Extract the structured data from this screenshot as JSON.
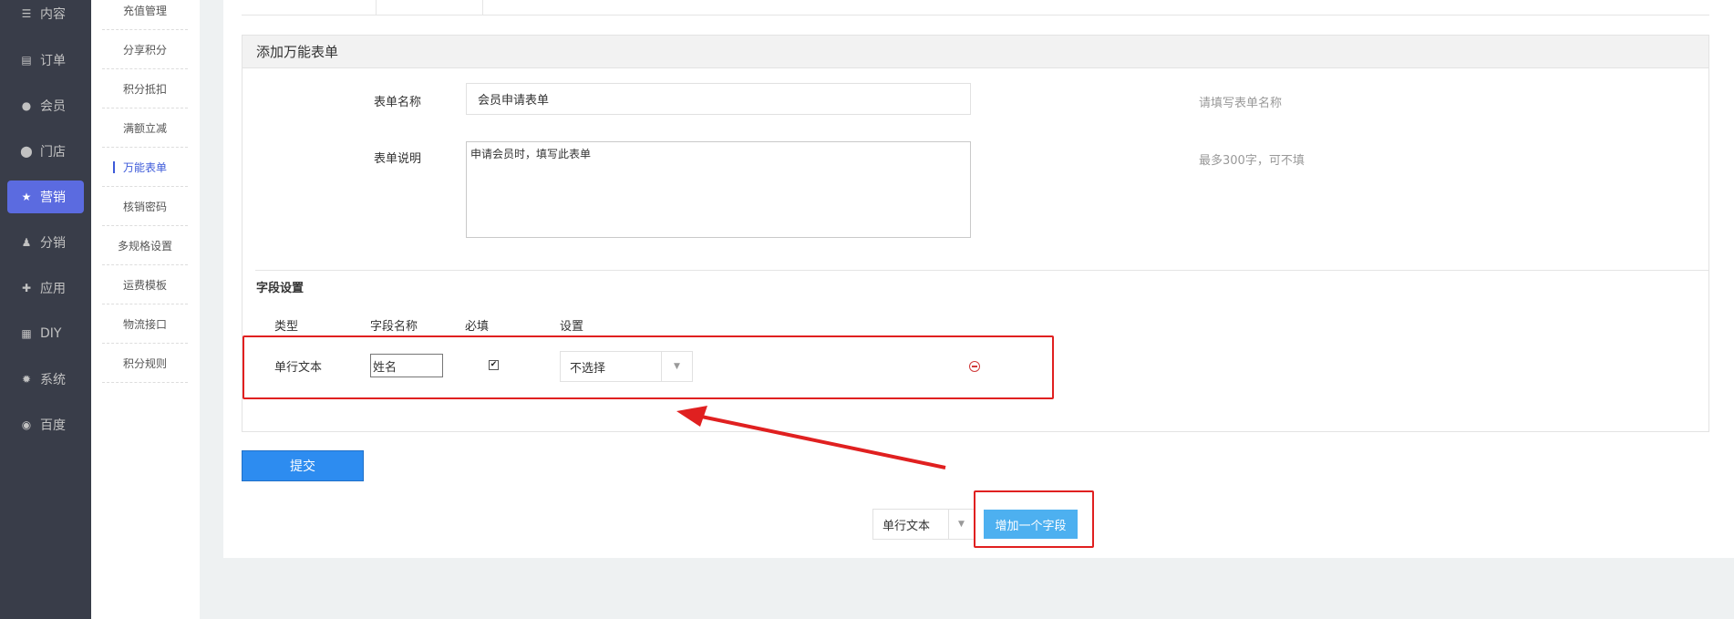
{
  "nav": {
    "items": [
      {
        "label": "内容",
        "icon": "list-icon"
      },
      {
        "label": "订单",
        "icon": "order-icon"
      },
      {
        "label": "会员",
        "icon": "user-icon"
      },
      {
        "label": "门店",
        "icon": "location-icon"
      },
      {
        "label": "营销",
        "icon": "star-icon"
      },
      {
        "label": "分销",
        "icon": "users-icon"
      },
      {
        "label": "应用",
        "icon": "puzzle-icon"
      },
      {
        "label": "DIY",
        "icon": "layout-icon"
      },
      {
        "label": "系统",
        "icon": "gear-icon"
      },
      {
        "label": "百度",
        "icon": "baidu-icon"
      }
    ],
    "active_index": 4
  },
  "subnav": {
    "items": [
      "充值管理",
      "分享积分",
      "积分抵扣",
      "满额立减",
      "万能表单",
      "核销密码",
      "多规格设置",
      "运费模板",
      "物流接口",
      "积分规则"
    ],
    "active_index": 4
  },
  "form": {
    "card_title": "添加万能表单",
    "name_label": "表单名称",
    "name_value": "会员申请表单",
    "name_hint": "请填写表单名称",
    "desc_label": "表单说明",
    "desc_value": "申请会员时，填写此表单",
    "desc_hint": "最多300字，可不填",
    "fields_title": "字段设置",
    "columns": [
      "类型",
      "字段名称",
      "必填",
      "设置"
    ],
    "field_rows": [
      {
        "type": "单行文本",
        "name": "姓名",
        "required": true,
        "setting": "不选择"
      }
    ],
    "submit_label": "提交",
    "add_type_value": "单行文本",
    "add_field_label": "增加一个字段"
  },
  "colors": {
    "nav_bg": "#393d49",
    "nav_active": "#5b6be0",
    "submit_blue": "#2d8cf0",
    "add_blue": "#4db0f0",
    "highlight_red": "#e02020"
  }
}
